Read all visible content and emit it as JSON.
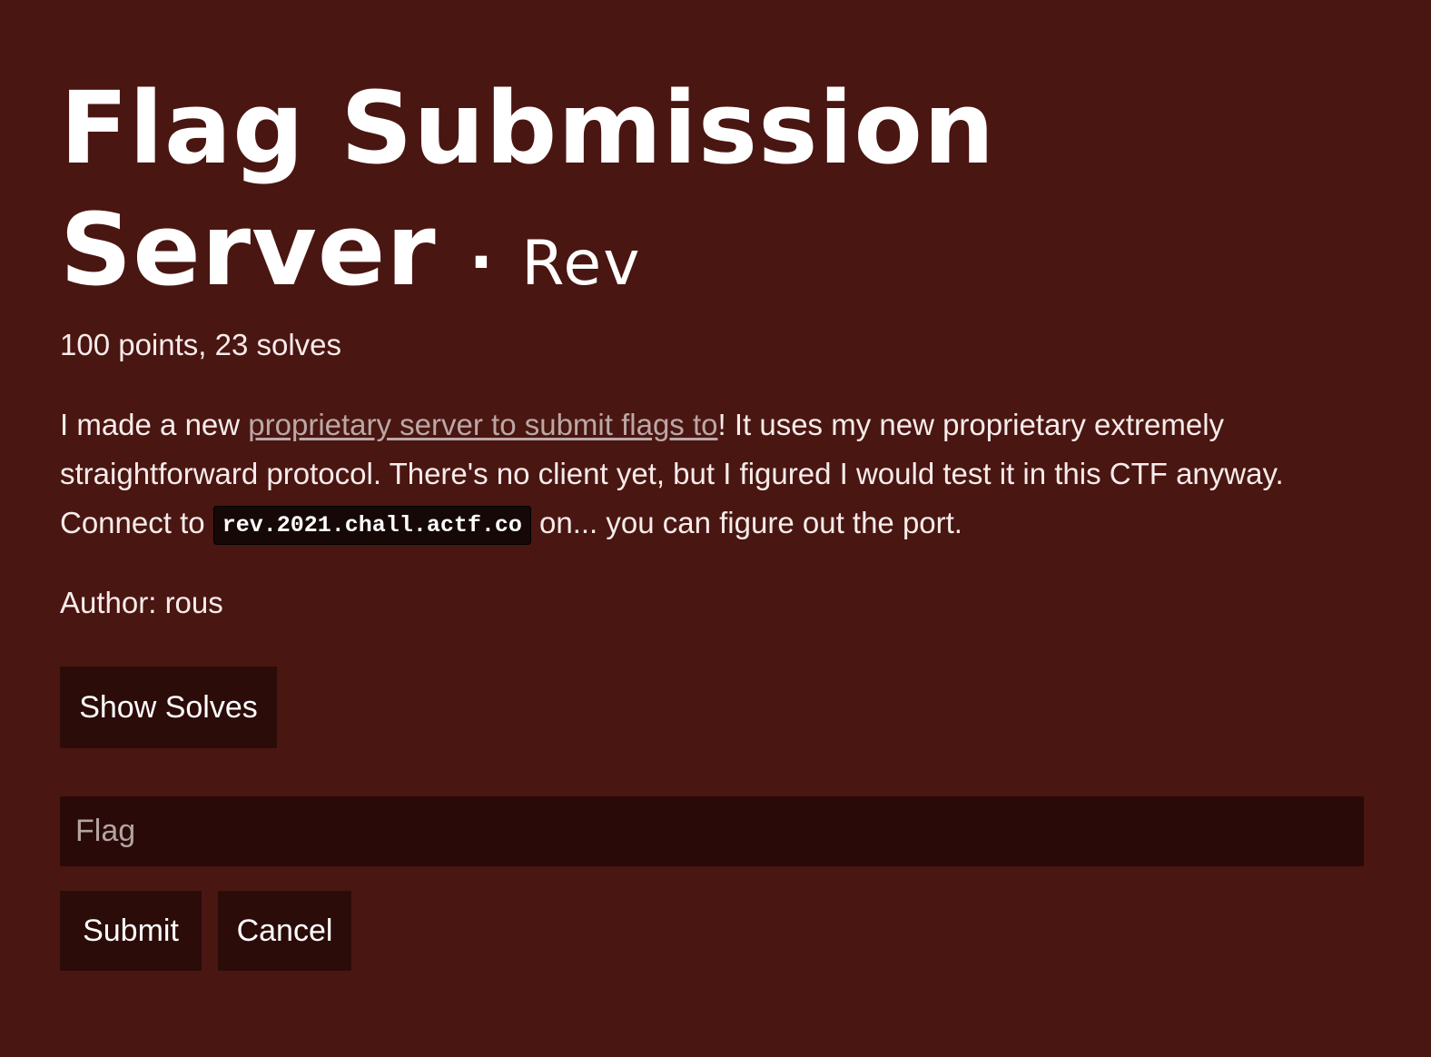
{
  "challenge": {
    "title": "Flag Submission Server",
    "separator": "·",
    "category": "Rev",
    "stats": "100 points, 23 solves",
    "description": {
      "intro": "I made a new ",
      "link_text": "proprietary server to submit flags to",
      "after_link": "! It uses my new proprietary extremely straightforward protocol. There's no client yet, but I figured I would test it in this CTF anyway. Connect to ",
      "host": "rev.2021.chall.actf.co",
      "ending": " on... you can figure out the port."
    },
    "author": "Author: rous"
  },
  "buttons": {
    "show_solves": "Show Solves",
    "submit": "Submit",
    "cancel": "Cancel"
  },
  "flag_input": {
    "placeholder": "Flag",
    "value": ""
  },
  "colors": {
    "background": "#4a1612",
    "button_bg": "#2b0c09",
    "input_bg": "#2a0a08",
    "link": "#bba8a5"
  }
}
